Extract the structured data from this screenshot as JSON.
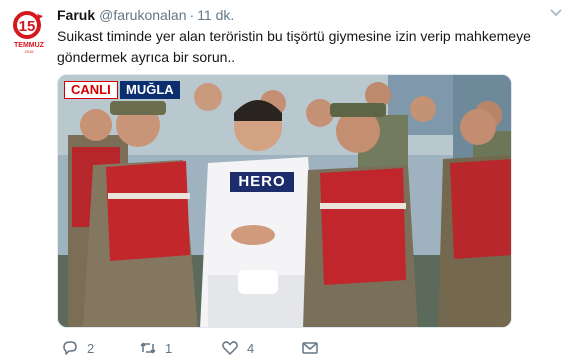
{
  "avatar": {
    "icon": "temmuz-15-logo-icon",
    "logo_text": "15 TEMMUZ",
    "brand_color": "#d4191e"
  },
  "tweet": {
    "display_name": "Faruk",
    "handle": "@farukonalan",
    "separator": "·",
    "time": "11 dk.",
    "text": "Suikast timinde yer alan teröristin bu tişörtü giymesine izin verip mahkemeye göndermek ayrıca bir sorun..",
    "caret_icon": "chevron-down-icon"
  },
  "media": {
    "live_badge": "CANLI",
    "location_badge": "MUĞLA",
    "shirt_text": "HERO"
  },
  "actions": {
    "reply": {
      "icon": "reply-icon",
      "count": "2"
    },
    "retweet": {
      "icon": "retweet-icon",
      "count": "1"
    },
    "like": {
      "icon": "heart-icon",
      "count": "4"
    },
    "dm": {
      "icon": "direct-message-icon"
    }
  }
}
